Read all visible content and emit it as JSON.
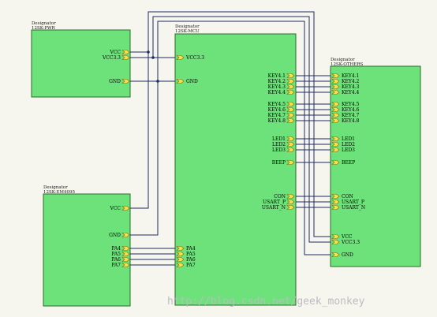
{
  "designator_label": "Designator",
  "pwr": {
    "name": "12SK-PWR",
    "ports": [
      "VCC",
      "VCC3.3",
      "GND"
    ]
  },
  "em": {
    "name": "12SK-EM4095",
    "ports": [
      "VCC",
      "GND",
      "PA4",
      "PA5",
      "PA6",
      "PA7"
    ]
  },
  "mcu": {
    "name": "12SK-MCU",
    "left_ports": [
      "VCC3.3",
      "GND",
      "PA4",
      "PA5",
      "PA6",
      "PA7"
    ],
    "right_ports": [
      "KEY4.1",
      "KEY4.2",
      "KEY4.3",
      "KEY4.4",
      "KEY4.5",
      "KEY4.6",
      "KEY4.7",
      "KEY4.8",
      "LED1",
      "LED2",
      "LED3",
      "BEEP",
      "CON",
      "USART_P",
      "USART_N"
    ]
  },
  "others": {
    "name": "12SK-OTHERS",
    "ports": [
      "KEY4.1",
      "KEY4.2",
      "KEY4.3",
      "KEY4.4",
      "KEY4.5",
      "KEY4.6",
      "KEY4.7",
      "KEY4.8",
      "LED1",
      "LED2",
      "LED3",
      "BEEP",
      "CON",
      "USART_P",
      "USART_N",
      "VCC",
      "VCC3.3",
      "GND"
    ]
  },
  "watermark": "http://blog.csdn.net/geek_monkey",
  "colors": {
    "background": "#f7f6ee",
    "sheet_fill": "#6ee27a",
    "port_fill": "#f7e04a",
    "wire": "#1e2a66"
  }
}
